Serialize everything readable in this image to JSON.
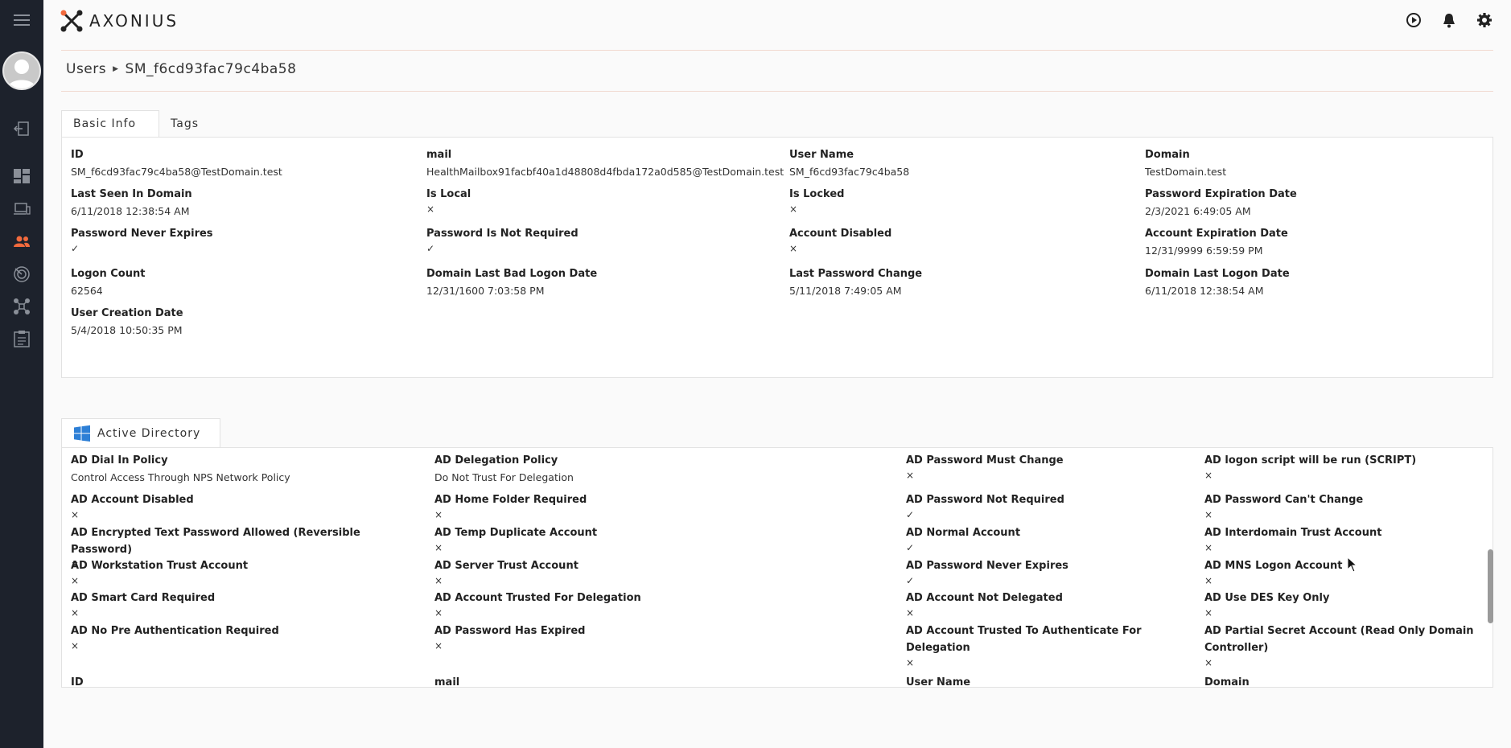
{
  "app": {
    "logo_text": "AXONIUS"
  },
  "nav": {
    "items": [
      "menu-icon",
      "avatar",
      "logout-icon",
      "dashboard-icon",
      "devices-icon",
      "users-icon",
      "alerts-icon",
      "adapters-icon",
      "reports-icon"
    ]
  },
  "breadcrumb": {
    "root": "Users",
    "current": "SM_f6cd93fac79c4ba58"
  },
  "basic_info": {
    "tabs": [
      {
        "label": "Basic Info"
      },
      {
        "label": "Tags"
      }
    ],
    "fields": [
      {
        "label": "ID",
        "value": "SM_f6cd93fac79c4ba58@TestDomain.test"
      },
      {
        "label": "mail",
        "value": "HealthMailbox91facbf40a1d48808d4fbda172a0d585@TestDomain.test"
      },
      {
        "label": "User Name",
        "value": "SM_f6cd93fac79c4ba58"
      },
      {
        "label": "Domain",
        "value": "TestDomain.test"
      },
      {
        "label": "Last Seen In Domain",
        "value": "6/11/2018 12:38:54 AM"
      },
      {
        "label": "Is Local",
        "value": "×"
      },
      {
        "label": "Is Locked",
        "value": "×"
      },
      {
        "label": "Password Expiration Date",
        "value": "2/3/2021 6:49:05 AM"
      },
      {
        "label": "Password Never Expires",
        "value": "✓"
      },
      {
        "label": "Password Is Not Required",
        "value": "✓"
      },
      {
        "label": "Account Disabled",
        "value": "×"
      },
      {
        "label": "Account Expiration Date",
        "value": "12/31/9999 6:59:59 PM"
      },
      {
        "label": "Logon Count",
        "value": "62564"
      },
      {
        "label": "Domain Last Bad Logon Date",
        "value": "12/31/1600 7:03:58 PM"
      },
      {
        "label": "Last Password Change",
        "value": "5/11/2018 7:49:05 AM"
      },
      {
        "label": "Domain Last Logon Date",
        "value": "6/11/2018 12:38:54 AM"
      },
      {
        "label": "User Creation Date",
        "value": "5/4/2018 10:50:35 PM"
      }
    ]
  },
  "active_directory": {
    "tab_label": "Active Directory",
    "fields": [
      {
        "label": "AD Dial In Policy",
        "value": "Control Access Through NPS Network Policy"
      },
      {
        "label": "AD Delegation Policy",
        "value": "Do Not Trust For Delegation"
      },
      {
        "label": "AD Password Must Change",
        "value": "×"
      },
      {
        "label": "AD logon script will be run (SCRIPT)",
        "value": "×"
      },
      {
        "label": "AD Account Disabled",
        "value": "×"
      },
      {
        "label": "AD Home Folder Required",
        "value": "×"
      },
      {
        "label": "AD Password Not Required",
        "value": "✓"
      },
      {
        "label": "AD Password Can't Change",
        "value": "×"
      },
      {
        "label": "AD Encrypted Text Password Allowed (Reversible Password)",
        "value": "×"
      },
      {
        "label": "AD Temp Duplicate Account",
        "value": "×"
      },
      {
        "label": "AD Normal Account",
        "value": "✓"
      },
      {
        "label": "AD Interdomain Trust Account",
        "value": "×"
      },
      {
        "label": "AD Workstation Trust Account",
        "value": "×"
      },
      {
        "label": "AD Server Trust Account",
        "value": "×"
      },
      {
        "label": "AD Password Never Expires",
        "value": "✓"
      },
      {
        "label": "AD MNS Logon Account",
        "value": "×"
      },
      {
        "label": "AD Smart Card Required",
        "value": "×"
      },
      {
        "label": "AD Account Trusted For Delegation",
        "value": "×"
      },
      {
        "label": "AD Account Not Delegated",
        "value": "×"
      },
      {
        "label": "AD Use DES Key Only",
        "value": "×"
      },
      {
        "label": "AD No Pre Authentication Required",
        "value": "×"
      },
      {
        "label": "AD Password Has Expired",
        "value": "×"
      },
      {
        "label": "AD Account Trusted To Authenticate For Delegation",
        "value": "×"
      },
      {
        "label": "AD Partial Secret Account (Read Only Domain Controller)",
        "value": "×"
      },
      {
        "label": "ID",
        "value": ""
      },
      {
        "label": "mail",
        "value": ""
      },
      {
        "label": "User Name",
        "value": ""
      },
      {
        "label": "Domain",
        "value": ""
      }
    ]
  },
  "colors": {
    "accent": "#f26a3d",
    "rail_bg": "#1d222c",
    "windows_blue": "#2d7fd6"
  }
}
